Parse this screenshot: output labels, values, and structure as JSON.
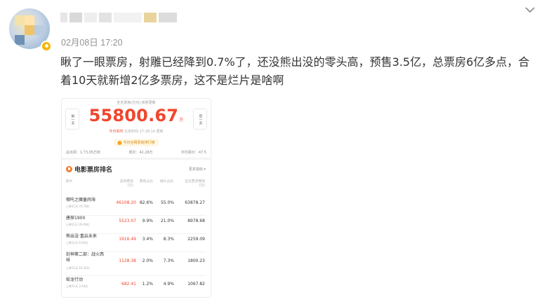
{
  "post": {
    "timestamp": "02月08日 17:20",
    "text": "瞅了一眼票房，射雕已经降到0.7%了，还没熊出没的零头高，预售3.5亿，总票房6亿多点，合着10天就新增2亿多票房，这不是烂片是啥啊",
    "colors": {
      "text": "#333333",
      "meta": "#939393",
      "accent_red": "#f0462d"
    }
  },
  "card": {
    "top_note": "全天票房(万元)·实时更新",
    "total": "55800.67",
    "total_unit": "万",
    "prev_day": "前一天",
    "next_day": "后一天",
    "realtime": "今日实时",
    "updated": "北京时间 17:18:14 更新",
    "pill": "今日全网票房排行榜",
    "stats": [
      "总出票：1,73,05万张",
      "场次：42.28万",
      "平均票价：47.5"
    ],
    "section_title": "电影票房排名",
    "more": "更多指标 ▾",
    "columns": [
      "影片",
      "实时票房(万)",
      "票房占比",
      "排片占比",
      "全天票房预测(万)"
    ],
    "rows": [
      {
        "name": "哪吒之魔童闹海",
        "sub": "上映11天 70.78亿",
        "gross": "46108.20",
        "share": "82.6%",
        "screens": "55.0%",
        "forecast": "63878.27"
      },
      {
        "name": "唐探1900",
        "sub": "上映11天 26.69亿",
        "gross": "5523.07",
        "share": "9.9%",
        "screens": "21.0%",
        "forecast": "8978.68"
      },
      {
        "name": "熊出没·重启未来",
        "sub": "上映11天 6.04亿",
        "gross": "1916.49",
        "share": "3.4%",
        "screens": "8.3%",
        "forecast": "2259.09"
      },
      {
        "name": "封神第二部：战火西岐",
        "sub": "上映11天 10.31亿",
        "gross": "1128.38",
        "share": "2.0%",
        "screens": "7.3%",
        "forecast": "1800.23"
      },
      {
        "name": "蛟龙行动",
        "sub": "上映11天 3.34亿",
        "gross": "682.41",
        "share": "1.2%",
        "screens": "4.9%",
        "forecast": "1067.82"
      }
    ]
  }
}
